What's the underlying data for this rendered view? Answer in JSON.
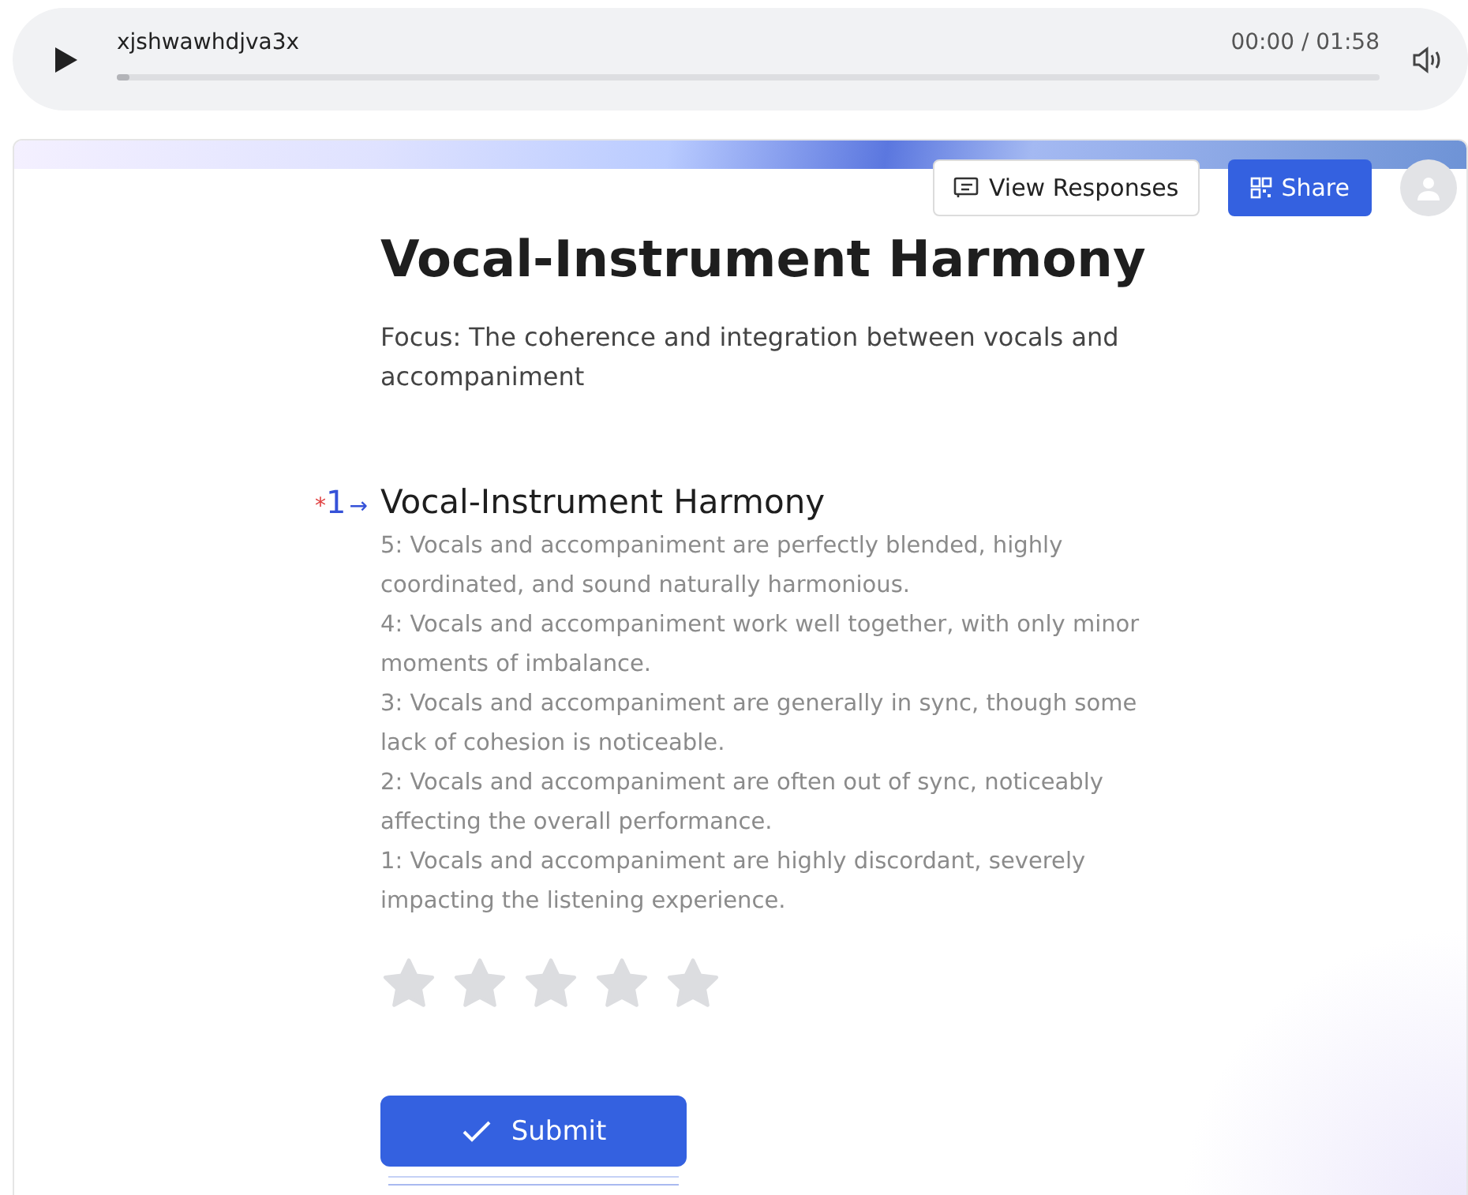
{
  "player": {
    "title": "xjshwawhdjva3x",
    "time": "00:00 / 01:58",
    "level": 0.01,
    "playing": false
  },
  "header": {
    "view_responses": "View Responses",
    "share": "Share"
  },
  "form": {
    "title": "Vocal-Instrument Harmony",
    "description": "Focus: The coherence and integration between vocals and accompaniment"
  },
  "questions": [
    {
      "required": true,
      "required_mark": "*",
      "number": "1",
      "arrow": "→",
      "title": "Vocal-Instrument Harmony",
      "stars": 0,
      "criteria": [
        "5: Vocals and accompaniment are perfectly blended, highly coordinated, and sound naturally harmonious.",
        "4: Vocals and accompaniment work well together, with only minor moments of imbalance.",
        "3: Vocals and accompaniment are generally in sync, though some lack of cohesion is noticeable.",
        "2: Vocals and accompaniment are often out of sync, noticeably affecting the overall performance.",
        "1: Vocals and accompaniment are highly discordant, severely impacting the listening experience."
      ]
    }
  ],
  "submit": "Submit"
}
